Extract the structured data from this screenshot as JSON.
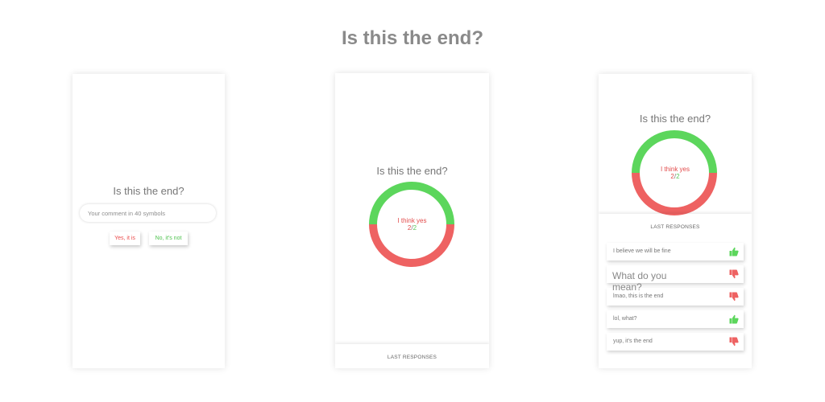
{
  "page_title": "Is this the end?",
  "question": "Is this the end?",
  "screen1": {
    "input_placeholder": "Your comment in 40 symbols",
    "yes_label": "Yes, it is",
    "no_label": "No, it's not"
  },
  "result": {
    "verdict": "I think yes",
    "count_a": "2",
    "count_sep": "/",
    "count_b": "2",
    "yes_fraction": 0.5,
    "no_fraction": 0.5
  },
  "colors": {
    "green": "#5cd65c",
    "red": "#ee6262"
  },
  "last_responses_label": "LAST RESPONSES",
  "overlay_text": "What do you mean?",
  "responses": [
    {
      "text": "I believe we will be fine",
      "icon": "thumbs-up-icon"
    },
    {
      "text": "",
      "icon": "thumbs-down-icon"
    },
    {
      "text": "lmao, this is the end",
      "icon": "thumbs-down-icon"
    },
    {
      "text": "lol, what?",
      "icon": "thumbs-up-icon"
    },
    {
      "text": "yup, it's the end",
      "icon": "thumbs-down-icon"
    }
  ]
}
